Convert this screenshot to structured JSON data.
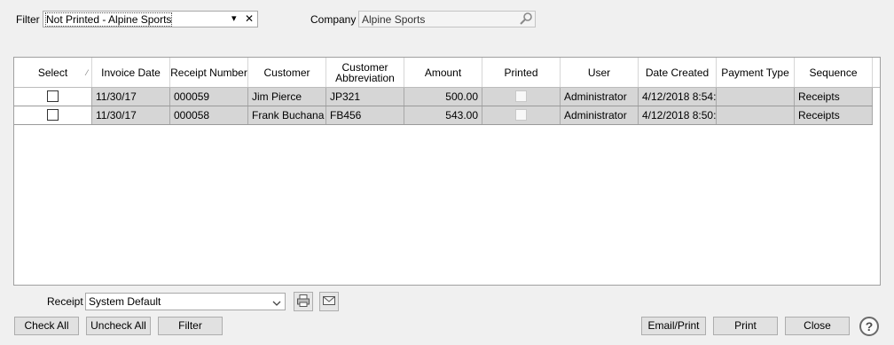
{
  "filter": {
    "label": "Filter",
    "value": "Not Printed - Alpine Sports",
    "clear_glyph": "✕",
    "dropdown_glyph": "▾"
  },
  "company": {
    "label": "Company",
    "value": "Alpine Sports"
  },
  "grid": {
    "columns": [
      "Select",
      "Invoice Date",
      "Receipt Number",
      "Customer",
      "Customer Abbreviation",
      "Amount",
      "Printed",
      "User",
      "Date Created",
      "Payment Type",
      "Sequence"
    ],
    "sort_glyph": "⁄",
    "rows": [
      {
        "selected": false,
        "invoice_date": "11/30/17",
        "receipt_number": "000059",
        "customer": "Jim Pierce",
        "customer_abbreviation": "JP321",
        "amount": "500.00",
        "printed": false,
        "user": "Administrator",
        "date_created": "4/12/2018 8:54:",
        "payment_type": "",
        "sequence": "Receipts"
      },
      {
        "selected": false,
        "invoice_date": "11/30/17",
        "receipt_number": "000058",
        "customer": "Frank Buchana",
        "customer_abbreviation": "FB456",
        "amount": "543.00",
        "printed": false,
        "user": "Administrator",
        "date_created": "4/12/2018 8:50:",
        "payment_type": "",
        "sequence": "Receipts"
      }
    ]
  },
  "receipt": {
    "label": "Receipt",
    "value": "System Default"
  },
  "buttons": {
    "check_all": "Check All",
    "uncheck_all": "Uncheck All",
    "filter": "Filter",
    "email_print": "Email/Print",
    "print": "Print",
    "close": "Close",
    "help": "?"
  }
}
